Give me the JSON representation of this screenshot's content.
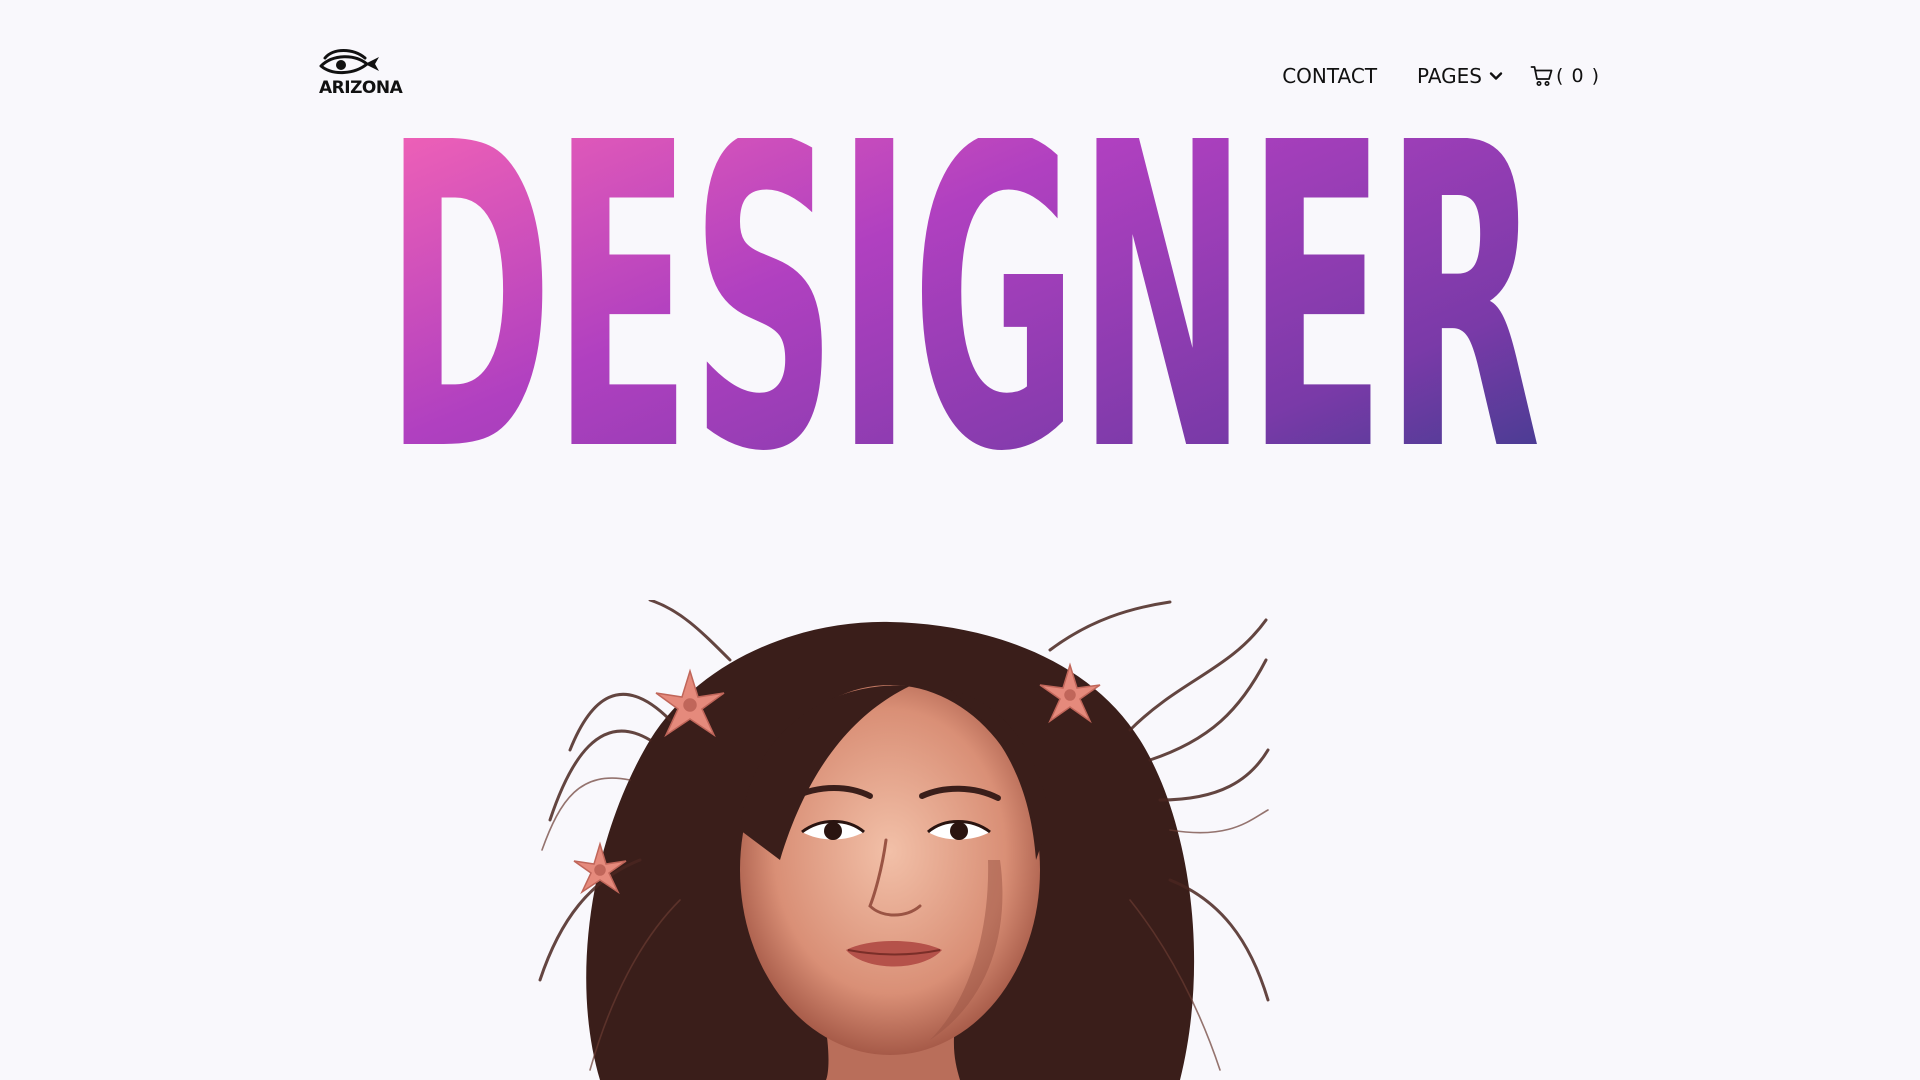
{
  "header": {
    "logo_text": "ARIZONA",
    "nav": {
      "contact_label": "CONTACT",
      "pages_label": "PAGES",
      "cart_count": "( 0 )"
    }
  },
  "hero": {
    "title": "DESIGNER",
    "gradient_colors": [
      "#ff69b4",
      "#b040c0",
      "#7a3aa8",
      "#2c3e86"
    ]
  },
  "icons": {
    "logo": "eye-fish-logo-icon",
    "pages_dropdown": "chevron-down-icon",
    "cart": "shopping-cart-icon"
  },
  "colors": {
    "background": "#f9f8fc",
    "text": "#111111"
  }
}
